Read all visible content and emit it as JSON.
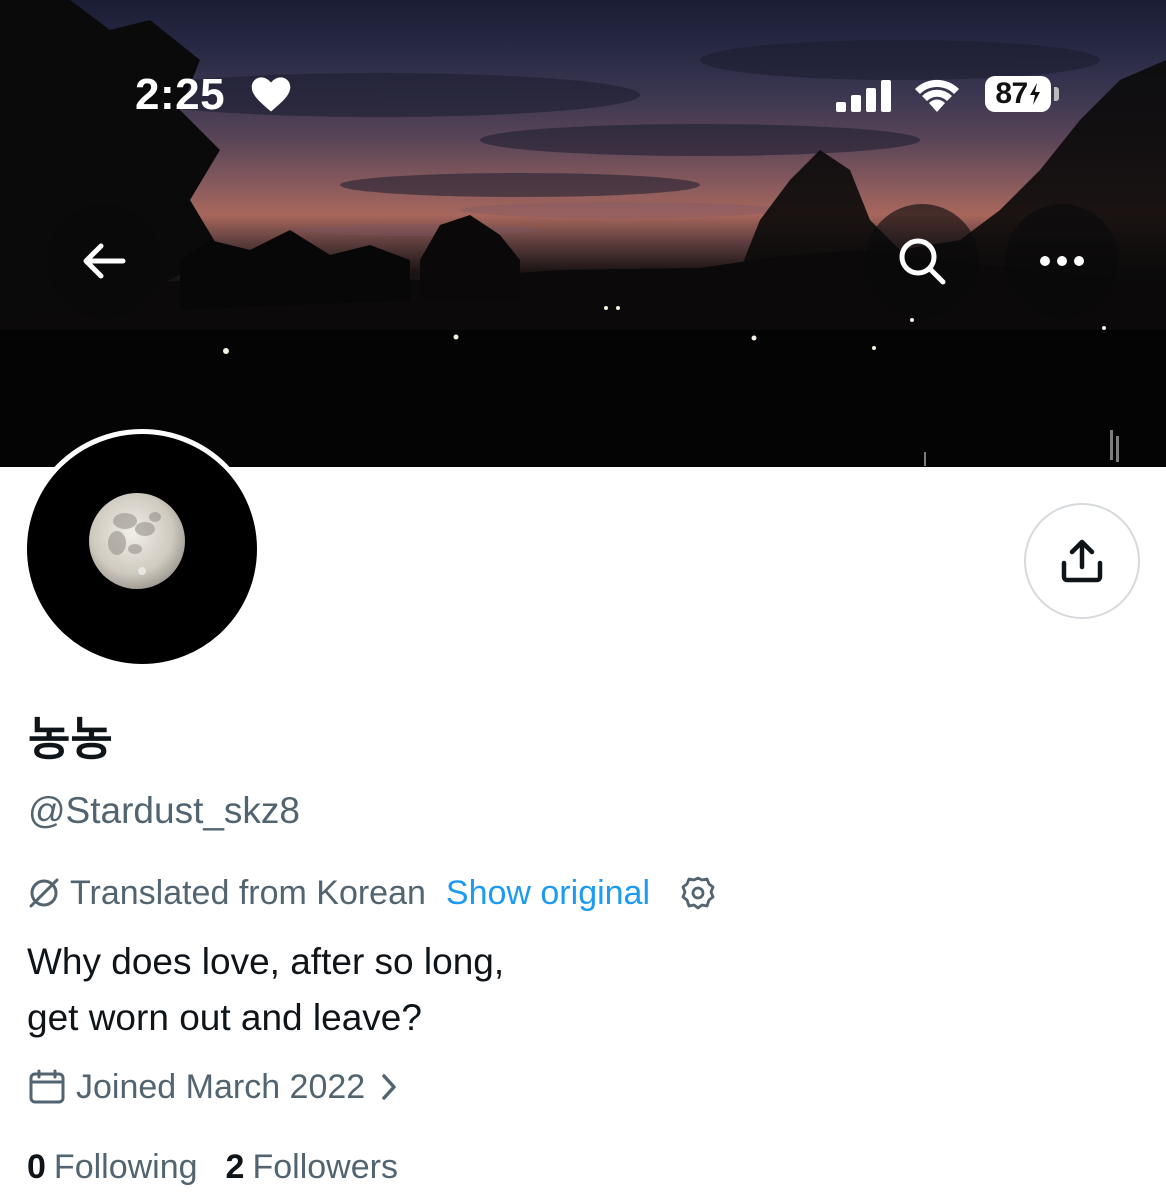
{
  "status_bar": {
    "time": "2:25",
    "battery": "87",
    "icons": [
      "heart-icon",
      "cellular-signal-icon",
      "wifi-icon",
      "battery-charging-icon"
    ]
  },
  "header": {
    "buttons": [
      "back-arrow-icon",
      "search-icon",
      "more-horizontal-icon"
    ]
  },
  "profile": {
    "display_name": "농농",
    "handle": "@Stardust_skz8",
    "translation": {
      "note": "Translated from Korean",
      "show_original": "Show original"
    },
    "bio_lines": [
      "Why does love, after so long,",
      "get worn out and leave?"
    ],
    "joined": "Joined March 2022",
    "following_count": "0",
    "following_label": "Following",
    "followers_count": "2",
    "followers_label": "Followers"
  },
  "colors": {
    "accent": "#1d9bf0",
    "secondary_text": "#536471",
    "primary_text": "#0f1419"
  }
}
